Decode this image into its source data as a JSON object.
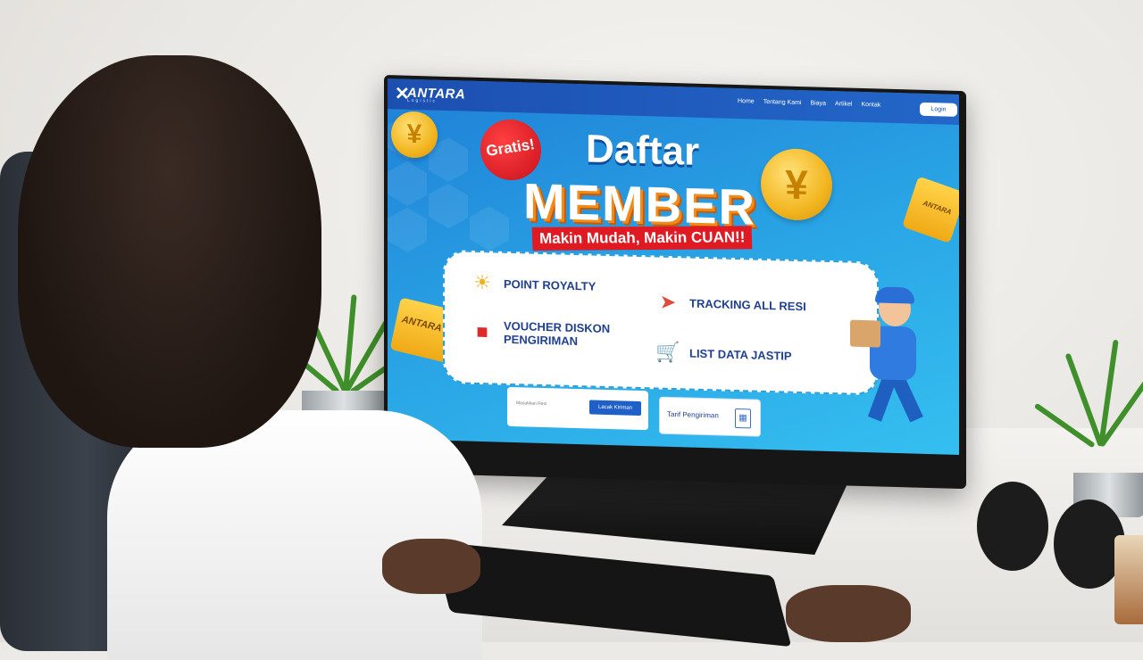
{
  "site": {
    "logo_text": "ANTARA",
    "logo_sub": "Logistic",
    "nav_links": [
      "Home",
      "Tentang Kami",
      "Biaya",
      "Artikel",
      "Kontak"
    ],
    "login_label": "Login"
  },
  "hero": {
    "badge": "Gratis!",
    "title_line1": "Daftar",
    "title_line2": "MEMBER",
    "tagline": "Makin Mudah, Makin CUAN!!",
    "ticket_text": "ANTARA"
  },
  "benefits": [
    {
      "label": "POINT ROYALTY",
      "icon": "sun-star-icon"
    },
    {
      "label": "TRACKING ALL RESI",
      "icon": "route-pin-icon"
    },
    {
      "label": "VOUCHER DISKON PENGIRIMAN",
      "icon": "voucher-icon"
    },
    {
      "label": "LIST DATA JASTIP",
      "icon": "shopping-cart-icon"
    }
  ],
  "tracking": {
    "placeholder": "Masukkan Resi",
    "button_label": "Lacak Kiriman"
  },
  "tarif": {
    "label": "Tarif Pengiriman"
  },
  "colors": {
    "nav": "#1c4fb0",
    "hero_blue": "#2aa6e6",
    "tagline_red": "#e01a22",
    "coin_gold": "#f2b51f"
  }
}
